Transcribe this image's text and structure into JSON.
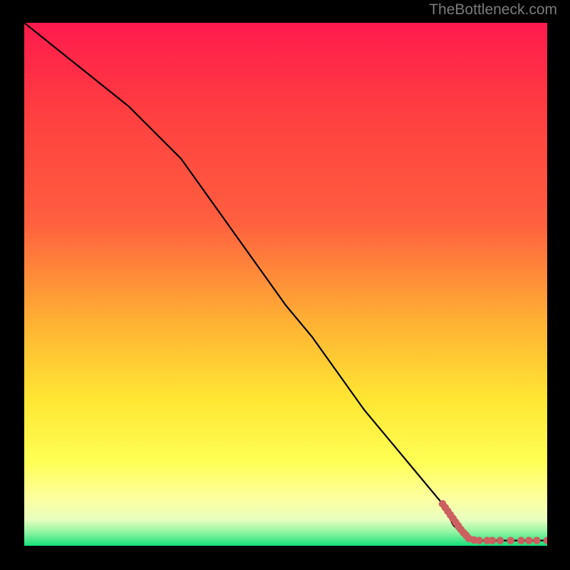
{
  "attribution": "TheBottleneck.com",
  "colors": {
    "bg_black": "#000000",
    "grad_top": "#ff1a4d",
    "grad_mid1": "#ff5f3f",
    "grad_mid2": "#ffb433",
    "grad_mid3": "#ffe633",
    "grad_mid4": "#ffff55",
    "grad_mid5": "#fdffa0",
    "grad_mid6": "#e8ffc0",
    "grad_bot": "#15e07a",
    "line": "#000000",
    "marker": "#cc5f5f"
  },
  "chart_data": {
    "type": "line",
    "title": "",
    "xlabel": "",
    "ylabel": "",
    "xlim": [
      0,
      100
    ],
    "ylim": [
      0,
      100
    ],
    "series": [
      {
        "name": "main-curve",
        "x": [
          0,
          5,
          10,
          15,
          20,
          25,
          30,
          35,
          40,
          45,
          50,
          55,
          60,
          65,
          70,
          75,
          80,
          82,
          84,
          85,
          86,
          88,
          90,
          92,
          94,
          96,
          98,
          100
        ],
        "y": [
          100,
          96,
          92,
          88,
          84,
          79,
          74,
          67,
          60,
          53,
          46,
          40,
          33,
          26,
          20,
          14,
          8,
          4,
          2,
          1,
          1,
          1,
          1,
          1,
          1,
          1,
          1,
          1
        ]
      }
    ],
    "markers": {
      "name": "highlight-points",
      "x": [
        80,
        80.5,
        81,
        81.5,
        82,
        82.5,
        83,
        83.5,
        84,
        84.5,
        85,
        86,
        87,
        88.5,
        89.5,
        91,
        93,
        95,
        96.5,
        98,
        100
      ],
      "y": [
        8,
        7.3,
        6.6,
        5.9,
        5.2,
        4.5,
        3.8,
        3.1,
        2.5,
        2.0,
        1.4,
        1.1,
        1.0,
        1.0,
        1.0,
        1.0,
        1.0,
        1.0,
        1.0,
        1.0,
        1.0
      ]
    }
  }
}
